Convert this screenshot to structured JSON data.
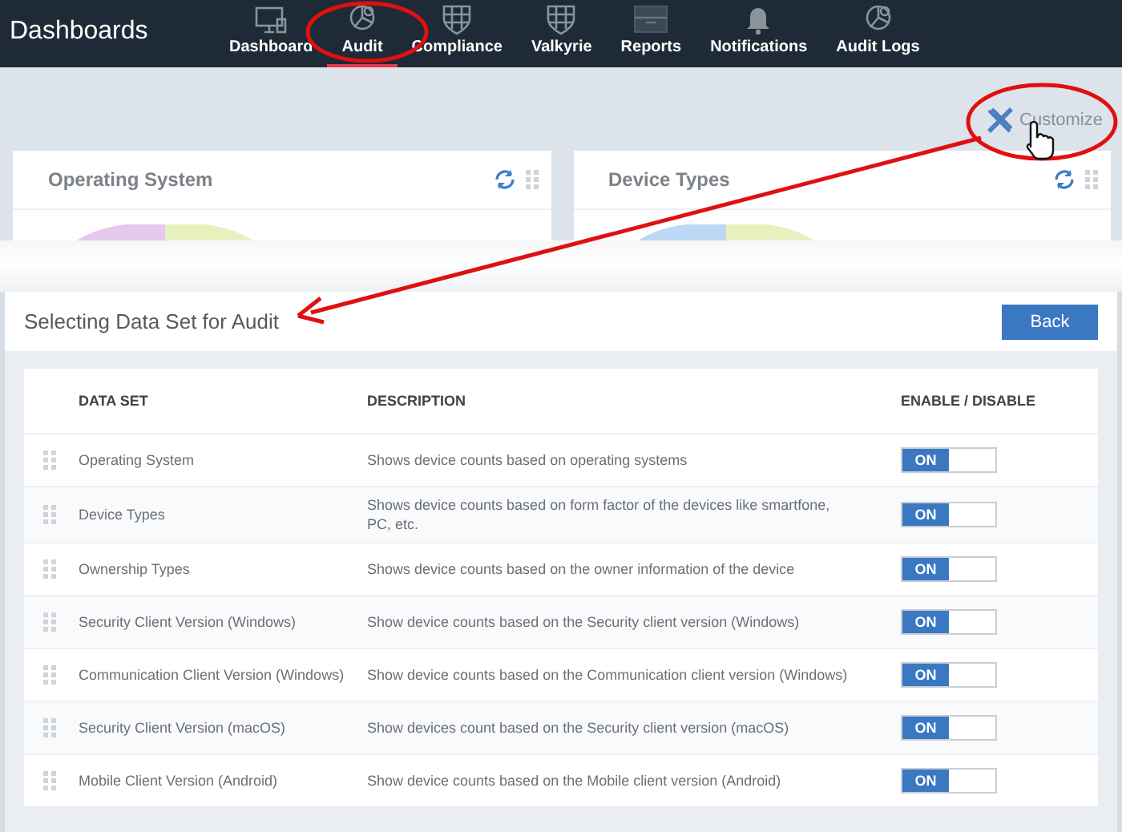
{
  "app_title": "Dashboards",
  "nav": [
    {
      "label": "Dashboard",
      "selected": false
    },
    {
      "label": "Audit",
      "selected": true
    },
    {
      "label": "Compliance",
      "selected": false
    },
    {
      "label": "Valkyrie",
      "selected": false
    },
    {
      "label": "Reports",
      "selected": false
    },
    {
      "label": "Notifications",
      "selected": false
    },
    {
      "label": "Audit Logs",
      "selected": false
    }
  ],
  "customize": "Customize",
  "cards": [
    {
      "title": "Operating System"
    },
    {
      "title": "Device Types"
    }
  ],
  "panel": {
    "title": "Selecting Data Set for Audit",
    "back_button": "Back",
    "columns": [
      "DATA SET",
      "DESCRIPTION",
      "ENABLE / DISABLE"
    ],
    "rows": [
      {
        "name": "Operating System",
        "description": "Shows device counts based on operating systems",
        "on": true,
        "toggle_label": "ON"
      },
      {
        "name": "Device Types",
        "description": "Shows device counts based on form factor of the devices like smartfone, PC, etc.",
        "on": true,
        "toggle_label": "ON"
      },
      {
        "name": "Ownership Types",
        "description": "Shows device counts based on the owner information of the device",
        "on": true,
        "toggle_label": "ON"
      },
      {
        "name": "Security Client Version (Windows)",
        "description": "Show device counts based on the Security client version (Windows)",
        "on": true,
        "toggle_label": "ON"
      },
      {
        "name": "Communication Client Version (Windows)",
        "description": "Show device counts based on the Communication client version (Windows)",
        "on": true,
        "toggle_label": "ON"
      },
      {
        "name": "Security Client Version (macOS)",
        "description": "Show devices count based on the Security client version (macOS)",
        "on": true,
        "toggle_label": "ON"
      },
      {
        "name": "Mobile Client Version (Android)",
        "description": "Show device counts based on the Mobile client version (Android)",
        "on": true,
        "toggle_label": "ON"
      }
    ]
  }
}
